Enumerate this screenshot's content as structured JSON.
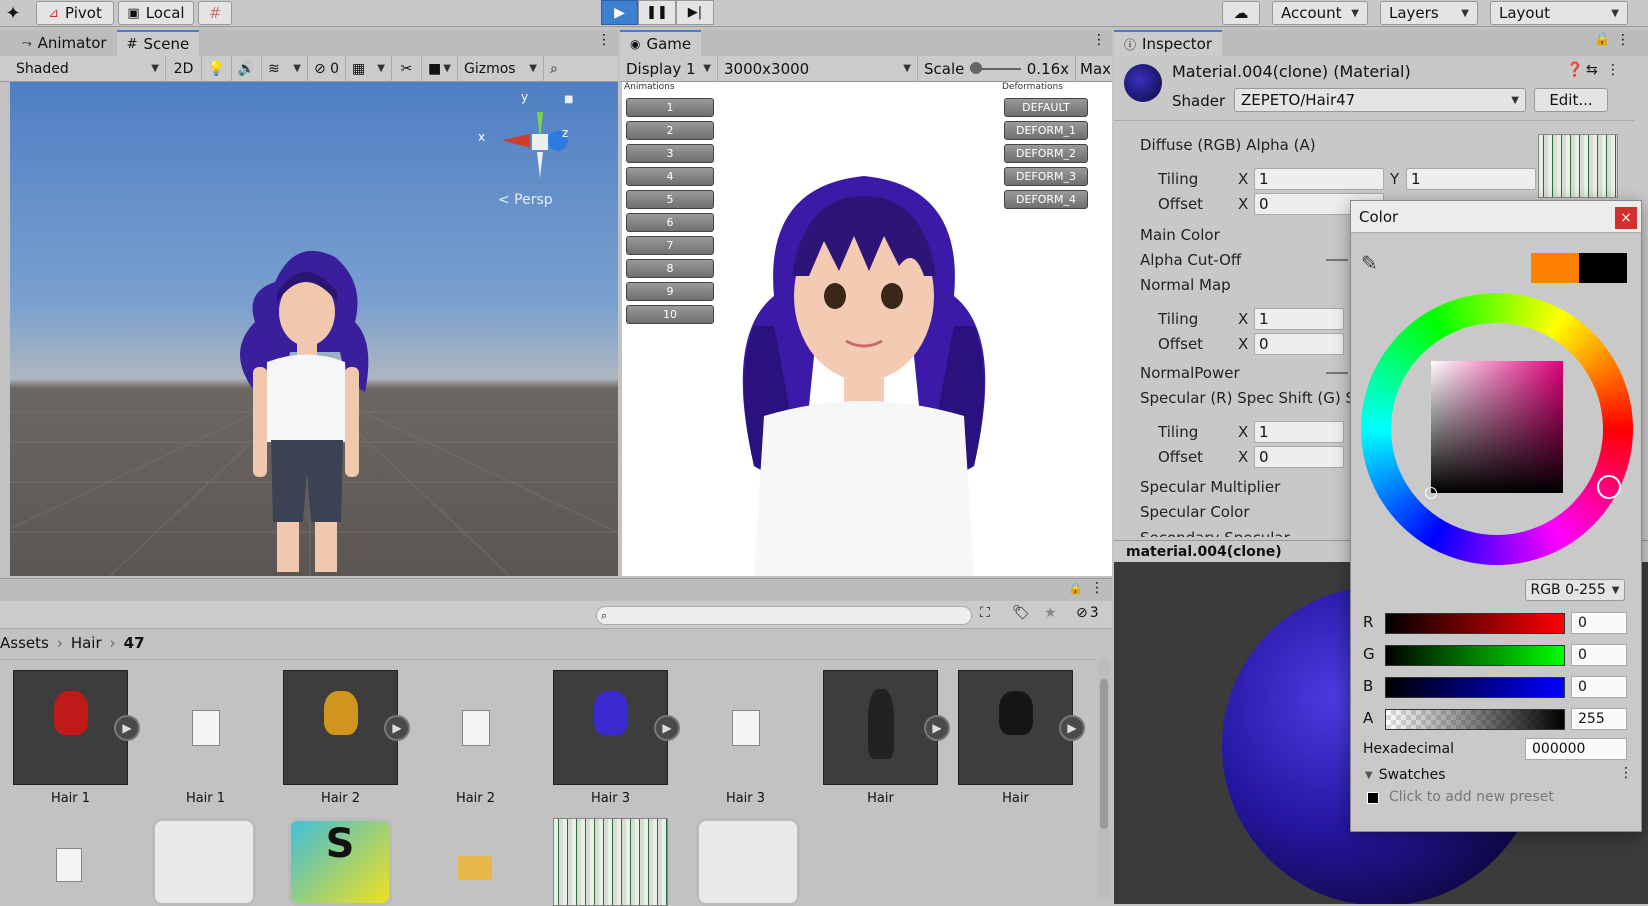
{
  "toolbar": {
    "pivot_label": "Pivot",
    "local_label": "Local",
    "account_label": "Account",
    "layers_label": "Layers",
    "layout_label": "Layout"
  },
  "scene": {
    "tab_animator": "Animator",
    "tab_scene": "Scene",
    "shading_mode": "Shaded",
    "mode_2d": "2D",
    "hidden_count": "0",
    "gizmos_label": "Gizmos",
    "gizmo_x": "x",
    "gizmo_y": "y",
    "gizmo_z": "z",
    "persp_label": "< Persp"
  },
  "game": {
    "tab_label": "Game",
    "display": "Display 1",
    "resolution": "3000x3000",
    "scale_label": "Scale",
    "scale_value": "0.16x",
    "max_label": "Max",
    "animations_label": "Animations",
    "deformations_label": "Deformations",
    "animation_buttons": [
      "1",
      "2",
      "3",
      "4",
      "5",
      "6",
      "7",
      "8",
      "9",
      "10"
    ],
    "deform_buttons": [
      "DEFAULT",
      "DEFORM_1",
      "DEFORM_2",
      "DEFORM_3",
      "DEFORM_4"
    ]
  },
  "inspector": {
    "tab_label": "Inspector",
    "material_name": "Material.004(clone) (Material)",
    "shader_label": "Shader",
    "shader_value": "ZEPETO/Hair47",
    "edit_label": "Edit...",
    "diffuse_label": "Diffuse (RGB) Alpha (A)",
    "tiling_label": "Tiling",
    "offset_label": "Offset",
    "x_label": "X",
    "y_label": "Y",
    "tiling_x": "1",
    "tiling_y": "1",
    "offset_x": "0",
    "main_color": "Main Color",
    "alpha_cutoff": "Alpha Cut-Off",
    "normal_map": "Normal Map",
    "normal_tiling_x": "1",
    "normal_offset_x": "0",
    "normal_power": "NormalPower",
    "specular_label": "Specular (R) Spec Shift (G) Sp",
    "spec_tiling_x": "1",
    "spec_offset_x": "0",
    "specular_multiplier": "Specular Multiplier",
    "specular_color": "Specular Color",
    "secondary_specular": "Secondary Specular Multiplie",
    "preview_title": "material.004(clone)"
  },
  "color_picker": {
    "title": "Color",
    "close": "×",
    "mode": "RGB 0-255",
    "channels": [
      {
        "label": "R",
        "value": "0"
      },
      {
        "label": "G",
        "value": "0"
      },
      {
        "label": "B",
        "value": "0"
      },
      {
        "label": "A",
        "value": "255"
      }
    ],
    "hex_label": "Hexadecimal",
    "hex_value": "000000",
    "swatches_label": "Swatches",
    "add_preset": "Click to add new preset",
    "previous_color": "#ff8000",
    "current_color": "#000000"
  },
  "project": {
    "breadcrumb": [
      "Assets",
      "Hair",
      "47"
    ],
    "hidden_count": "3",
    "assets": [
      "Hair 1",
      "Hair 1",
      "Hair 2",
      "Hair 2",
      "Hair 3",
      "Hair 3",
      "Hair",
      "Hair"
    ]
  }
}
